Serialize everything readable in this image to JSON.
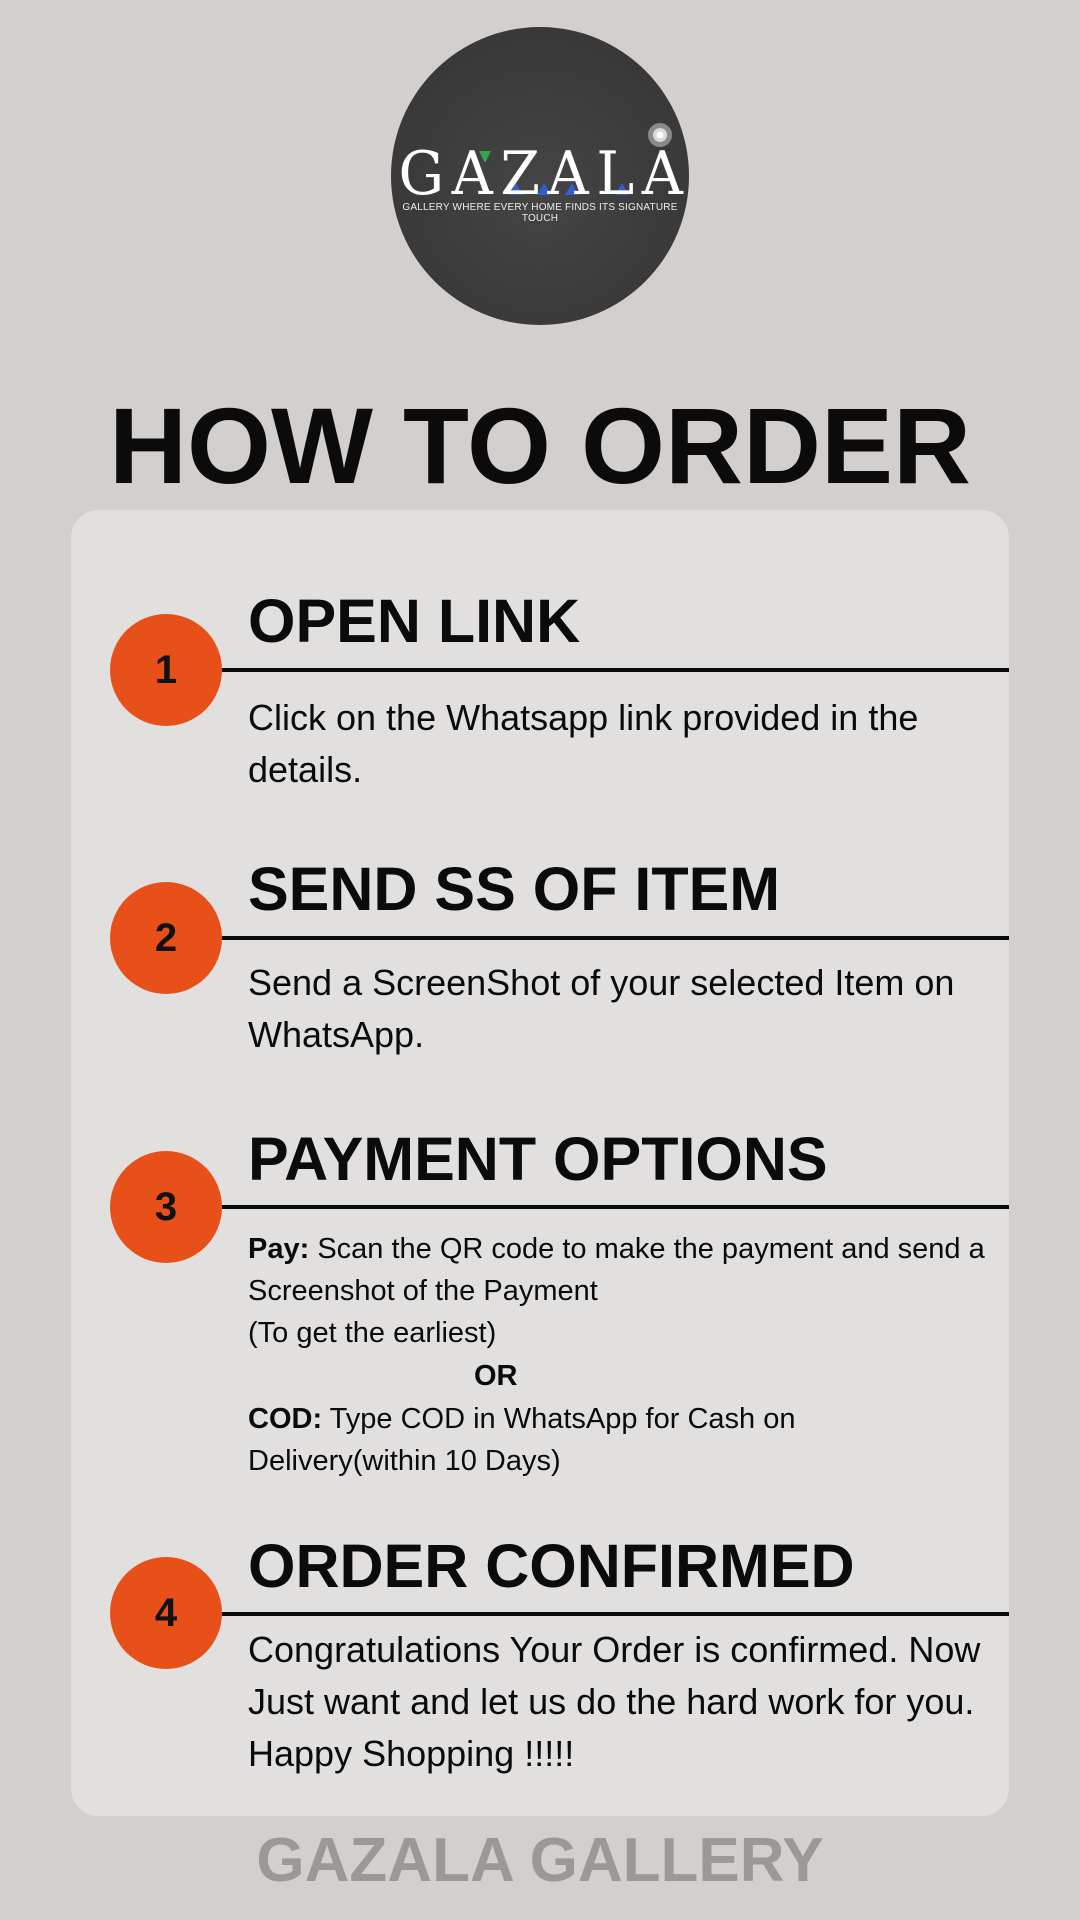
{
  "logo": {
    "brand": "GAZALA",
    "tagline": "GALLERY WHERE EVERY HOME FINDS ITS SIGNATURE TOUCH"
  },
  "title": "HOW TO ORDER",
  "steps": [
    {
      "number": "1",
      "title": "OPEN LINK",
      "body": "Click on the Whatsapp link provided in the details."
    },
    {
      "number": "2",
      "title": "SEND SS OF ITEM",
      "body": "Send a ScreenShot of your selected Item on WhatsApp."
    },
    {
      "number": "3",
      "title": "PAYMENT OPTIONS",
      "pay_label": "Pay:",
      "pay_text": " Scan the QR code to make the payment and send a Screenshot of the Payment",
      "pay_note": "(To get the earliest)",
      "or": "OR",
      "cod_label": "COD:",
      "cod_text": " Type COD in WhatsApp for Cash on Delivery(within 10 Days)"
    },
    {
      "number": "4",
      "title": "ORDER CONFIRMED",
      "body": "Congratulations Your Order is confirmed. Now Just want and let us do the hard work for you. Happy Shopping !!!!!"
    }
  ],
  "footer": "GAZALA GALLERY",
  "colors": {
    "background": "#d3cfcc",
    "card": "#e2e0df",
    "accent": "#e85019",
    "logo_circle": "#3c3c3c",
    "footer_text": "#9b9896"
  }
}
